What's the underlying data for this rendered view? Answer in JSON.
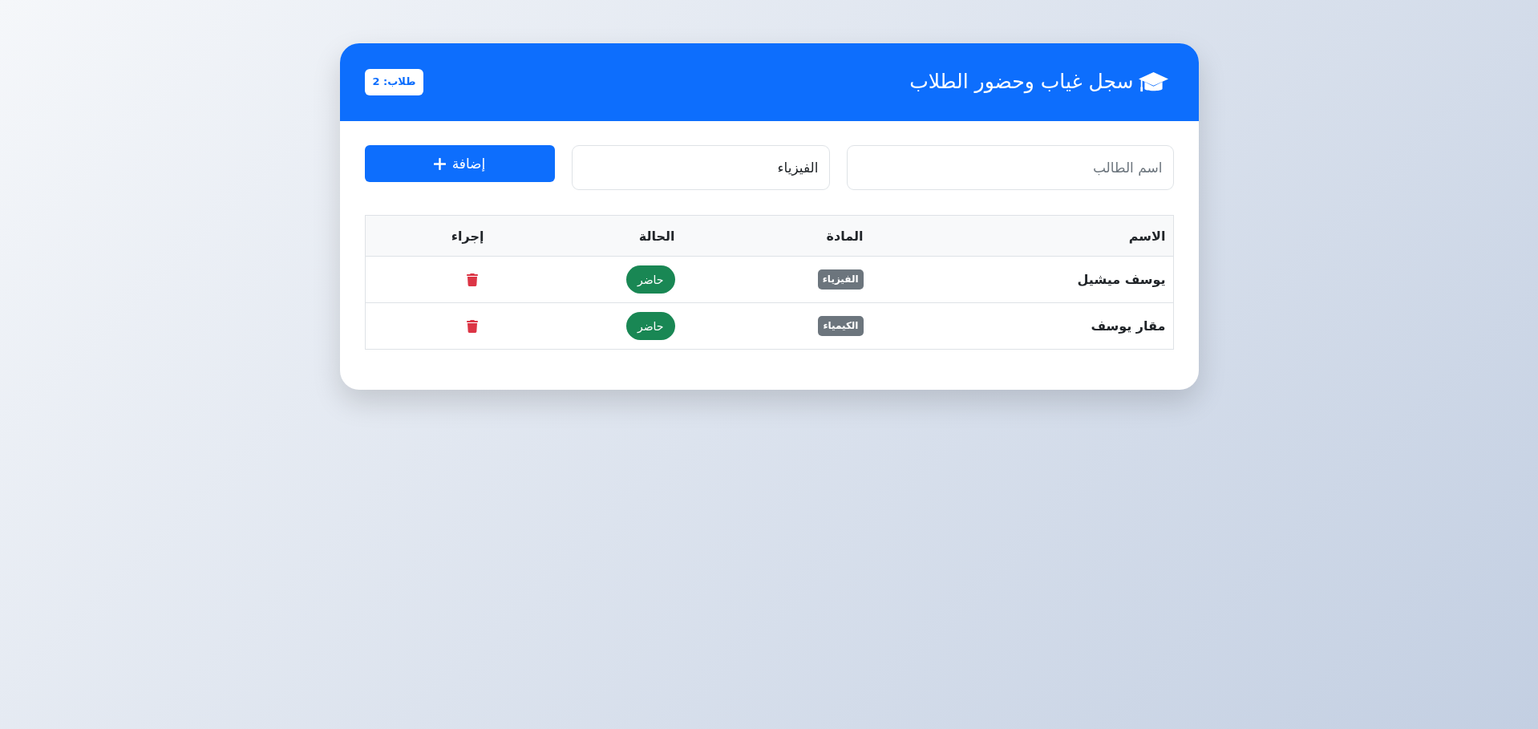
{
  "header": {
    "title": "سجل غياب وحضور الطلاب",
    "count_badge": "طلاب: 2"
  },
  "form": {
    "name_field": {
      "placeholder": "اسم الطالب"
    },
    "subject_field": {
      "value": "الفيزياء"
    },
    "add_button": "إضافة"
  },
  "table": {
    "columns": [
      "الاسم",
      "المادة",
      "الحالة",
      "إجراء"
    ],
    "rows": [
      {
        "name": "يوسف ميشيل",
        "subject": "الفيزياء",
        "status": {
          "label": "حاضر",
          "present": true
        }
      },
      {
        "name": "مقار يوسف",
        "subject": "الكيمياء",
        "status": {
          "label": "حاضر",
          "present": true
        }
      }
    ]
  }
}
